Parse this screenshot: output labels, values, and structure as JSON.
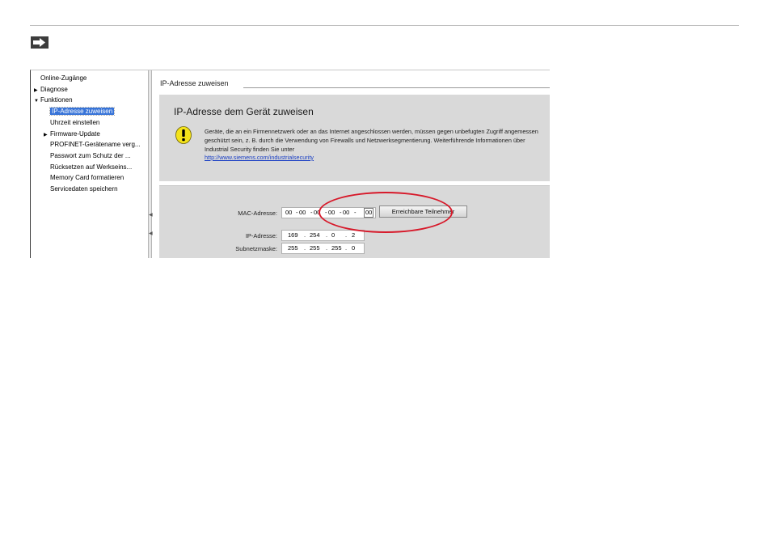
{
  "tree": {
    "items": [
      {
        "label": "Online-Zugänge",
        "indent": 0,
        "tri": ""
      },
      {
        "label": "Diagnose",
        "indent": 0,
        "tri": "▶"
      },
      {
        "label": "Funktionen",
        "indent": 0,
        "tri": "▼"
      },
      {
        "label": "IP-Adresse zuweisen",
        "indent": 1,
        "tri": ""
      },
      {
        "label": "Uhrzeit einstellen",
        "indent": 1,
        "tri": ""
      },
      {
        "label": "Firmware-Update",
        "indent": 1,
        "tri": "▶"
      },
      {
        "label": "PROFINET-Gerätename verg...",
        "indent": 1,
        "tri": ""
      },
      {
        "label": "Passwort zum Schutz der ...",
        "indent": 1,
        "tri": ""
      },
      {
        "label": "Rücksetzen auf Werkseins...",
        "indent": 1,
        "tri": ""
      },
      {
        "label": "Memory Card formatieren",
        "indent": 1,
        "tri": ""
      },
      {
        "label": "Servicedaten speichern",
        "indent": 1,
        "tri": ""
      }
    ],
    "selected_index": 3
  },
  "content": {
    "section_title": "IP-Adresse zuweisen",
    "panel_heading": "IP-Adresse dem Gerät zuweisen",
    "warning_text": "Geräte, die an ein Firmennetzwerk oder an das Internet angeschlossen werden, müssen gegen unbefugten Zugriff angemessen geschützt sein, z. B. durch die Verwendung von Firewalls und Netzwerksegmentierung. Weiterführende Informationen über Industrial Security finden Sie unter",
    "warning_link": "http://www.siemens.com/industrialsecurity",
    "mac_label": "MAC-Adresse:",
    "mac_octets": [
      "00",
      "00",
      "00",
      "00",
      "00",
      "00"
    ],
    "reachable_button": "Erreichbare Teilnehmer",
    "ip_label": "IP-Adresse:",
    "ip_octets": [
      "169",
      "254",
      "0",
      "2"
    ],
    "subnet_label": "Subnetzmaske:",
    "subnet_octets": [
      "255",
      "255",
      "255",
      "0"
    ]
  },
  "colors": {
    "selection": "#3874d8",
    "panel_bg": "#d9d9d9",
    "highlight_ellipse": "#d7192a",
    "link": "#1a3fc4"
  }
}
